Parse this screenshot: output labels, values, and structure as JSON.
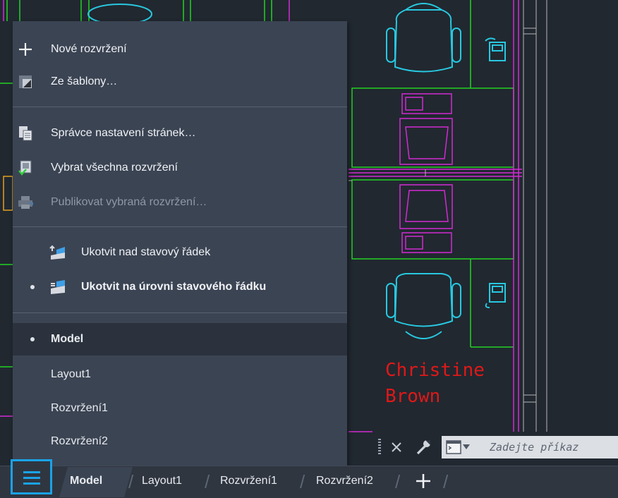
{
  "drawing": {
    "person_name_line1": "Christine",
    "person_name_line2": "Brown"
  },
  "menu": {
    "items": [
      {
        "label": "Nové rozvržení",
        "icon": "plus-icon",
        "enabled": true
      },
      {
        "label": "Ze šablony…",
        "icon": "template-icon",
        "enabled": true
      },
      {
        "label": "Správce nastavení stránek…",
        "icon": "page-setup-icon",
        "enabled": true
      },
      {
        "label": "Vybrat všechna rozvržení",
        "icon": "select-all-layouts-icon",
        "enabled": true
      },
      {
        "label": "Publikovat vybraná rozvržení…",
        "icon": "publish-icon",
        "enabled": false
      },
      {
        "label": "Ukotvit nad stavový řádek",
        "icon": "dock-above-icon",
        "enabled": true
      },
      {
        "label": "Ukotvit na úrovni stavového řádku",
        "icon": "dock-inline-icon",
        "enabled": true,
        "checked": true
      }
    ],
    "layouts": [
      {
        "label": "Model",
        "selected": true
      },
      {
        "label": "Layout1",
        "selected": false
      },
      {
        "label": "Rozvržení1",
        "selected": false
      },
      {
        "label": "Rozvržení2",
        "selected": false
      }
    ]
  },
  "command_line": {
    "placeholder": "Zadejte příkaz",
    "close_icon": "close-icon",
    "customize_icon": "wrench-icon",
    "history_icon": "command-prompt-icon"
  },
  "tabbar": {
    "menu_icon": "hamburger-icon",
    "tabs": [
      {
        "label": "Model",
        "active": true
      },
      {
        "label": "Layout1",
        "active": false
      },
      {
        "label": "Rozvržení1",
        "active": false
      },
      {
        "label": "Rozvržení2",
        "active": false
      }
    ],
    "add_icon": "plus-icon"
  },
  "colors": {
    "background": "#212830",
    "menu_bg": "#3b4453",
    "accent": "#1aa2e8",
    "cad_green": "#22d222",
    "cad_magenta": "#d22ad2",
    "cad_cyan": "#28c8e0",
    "cad_red": "#e01818"
  }
}
